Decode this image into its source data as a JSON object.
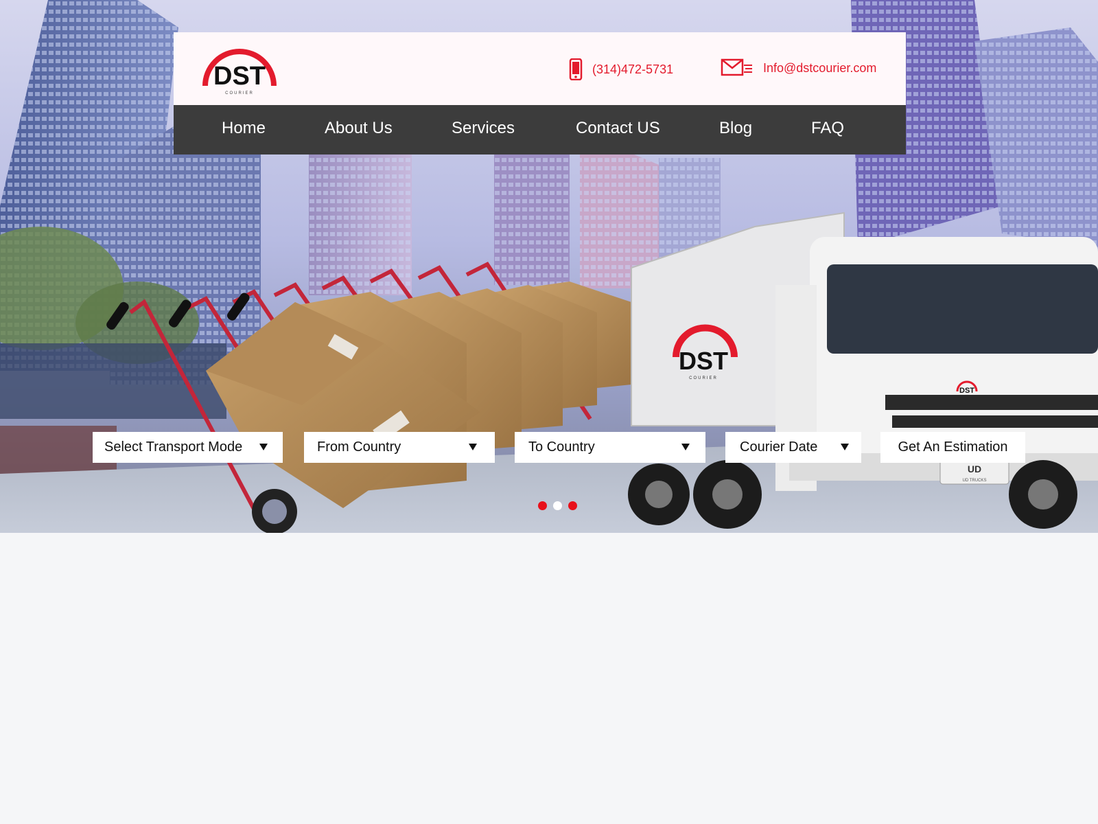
{
  "brand": {
    "logo_letters": "DST",
    "logo_tag": "COURIER",
    "accent": "#e31b2d"
  },
  "contact": {
    "phone_icon": "phone-icon",
    "phone": "(314)472-5731",
    "email_icon": "envelope-icon",
    "email": "Info@dstcourier.com"
  },
  "nav": {
    "items": [
      {
        "label": "Home"
      },
      {
        "label": "About Us"
      },
      {
        "label": "Services"
      },
      {
        "label": "Contact US"
      },
      {
        "label": "Blog"
      },
      {
        "label": "FAQ"
      }
    ],
    "background": "#3c3c3c"
  },
  "estimator": {
    "transport_mode": "Select Transport Mode",
    "from_country": "From Country",
    "to_country": "To Country",
    "courier_date": "Courier Date",
    "submit_label": "Get An Estimation"
  },
  "slider": {
    "slide_count": 3,
    "active_index": 1,
    "dot_color": "#e8101a",
    "active_dot_color": "#ffffff"
  },
  "truck": {
    "logo_letters": "DST",
    "logo_tag": "COURIER",
    "grille_logo": "DST",
    "badge": "UD",
    "badge_tag": "UD TRUCKS"
  }
}
